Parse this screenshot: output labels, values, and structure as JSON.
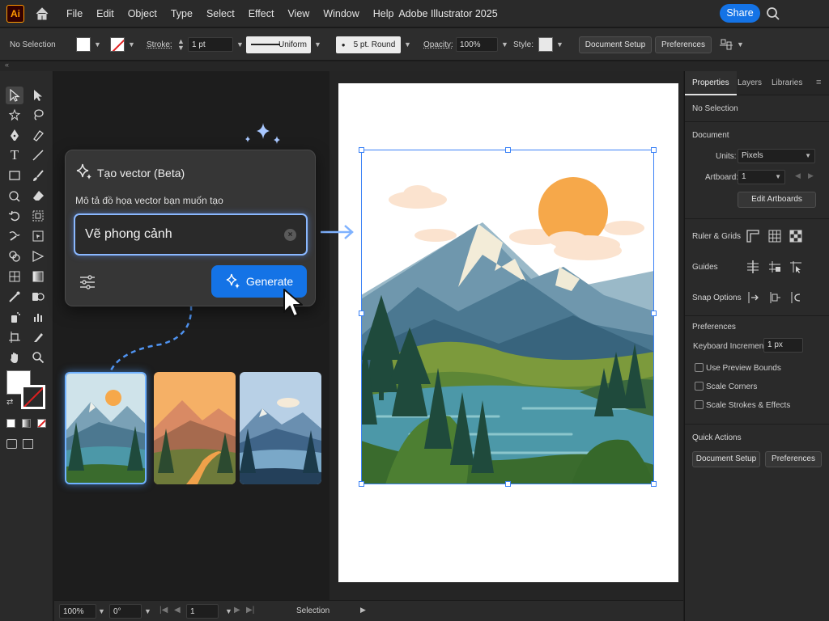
{
  "app": {
    "logo_text": "Ai",
    "title": "Adobe Illustrator 2025",
    "share_label": "Share"
  },
  "menu": [
    "File",
    "Edit",
    "Object",
    "Type",
    "Select",
    "Effect",
    "View",
    "Window",
    "Help"
  ],
  "control_bar": {
    "selection_state": "No Selection",
    "stroke_label": "Stroke:",
    "stroke_weight": "1 pt",
    "profile_label": "Uniform",
    "brush_label": "5 pt. Round",
    "opacity_label": "Opacity:",
    "opacity_value": "100%",
    "style_label": "Style:",
    "document_setup": "Document Setup",
    "preferences": "Preferences"
  },
  "generate_panel": {
    "title": "Tạo vector (Beta)",
    "description": "Mô tả đồ họa vector bạn muốn tạo",
    "input_value": "Vẽ phong cảnh",
    "clear_label": "×",
    "generate_label": "Generate"
  },
  "status_bar": {
    "zoom": "100%",
    "rotation": "0°",
    "artboard": "1",
    "tool": "Selection"
  },
  "properties": {
    "tabs": [
      "Properties",
      "Layers",
      "Libraries"
    ],
    "selection_state": "No Selection",
    "document_header": "Document",
    "units_label": "Units:",
    "units_value": "Pixels",
    "artboard_label": "Artboard:",
    "artboard_value": "1",
    "edit_artboards": "Edit Artboards",
    "ruler_grids": "Ruler & Grids",
    "guides": "Guides",
    "snap_options": "Snap Options",
    "preferences_header": "Preferences",
    "keyboard_increment_label": "Keyboard Increment:",
    "keyboard_increment_value": "1 px",
    "checkboxes": [
      "Use Preview Bounds",
      "Scale Corners",
      "Scale Strokes & Effects"
    ],
    "quick_actions": "Quick Actions",
    "qa_document_setup": "Document Setup",
    "qa_preferences": "Preferences"
  },
  "colors": {
    "accent": "#1473e6",
    "selection": "#3b82f6",
    "sun": "#f6a84a"
  }
}
